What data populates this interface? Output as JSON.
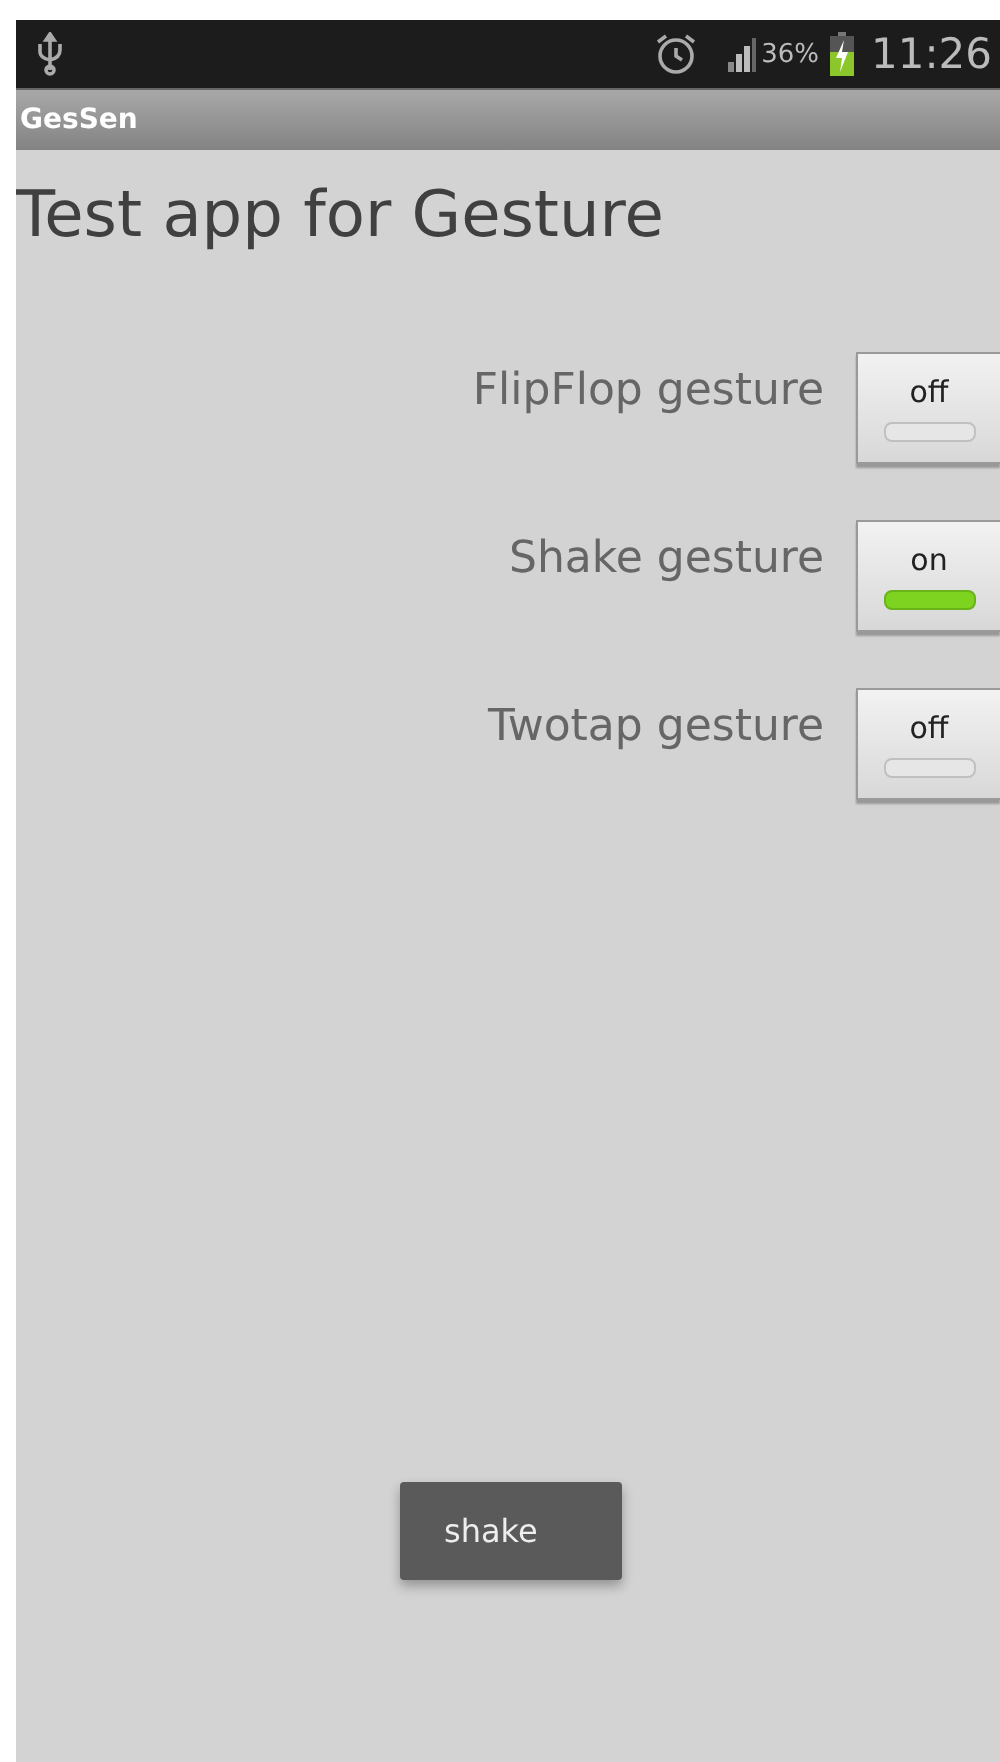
{
  "status_bar": {
    "battery": "36%",
    "time": "11:26"
  },
  "action_bar": {
    "title": "GesSen"
  },
  "heading": "Test app for Gesture",
  "toggles": [
    {
      "label": "FlipFlop gesture",
      "state": "off",
      "on": false
    },
    {
      "label": "Shake gesture",
      "state": "on",
      "on": true
    },
    {
      "label": "Twotap gesture",
      "state": "off",
      "on": false
    }
  ],
  "toast": "shake"
}
